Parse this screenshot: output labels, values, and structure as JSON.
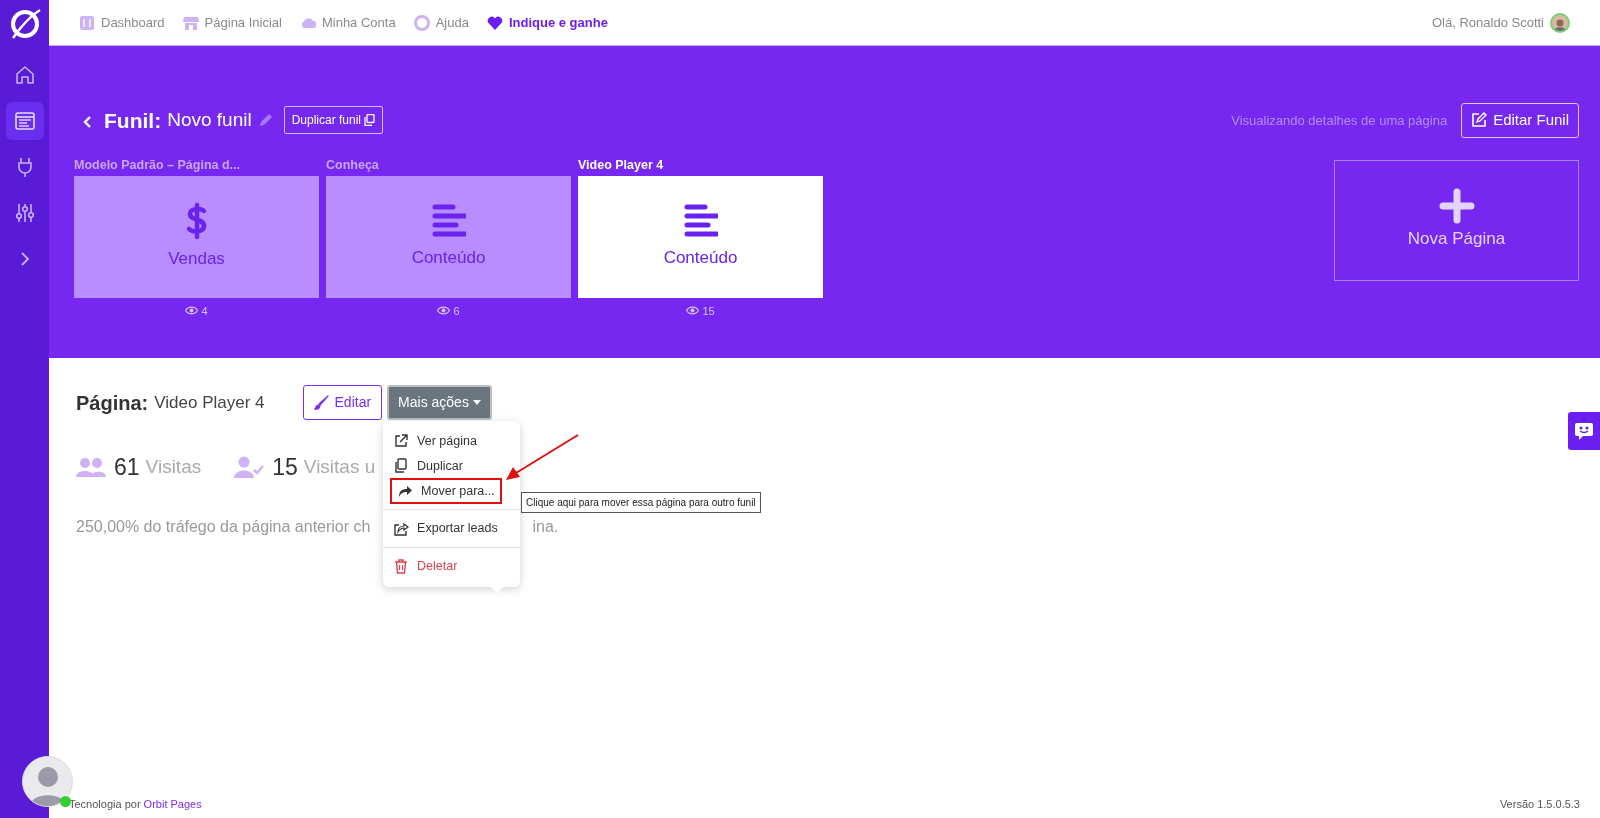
{
  "sidebar": {
    "items": [
      {
        "kind": "home",
        "selected": false
      },
      {
        "kind": "pages",
        "selected": true
      },
      {
        "kind": "plug",
        "selected": false
      },
      {
        "kind": "sliders",
        "selected": false
      },
      {
        "kind": "chevron",
        "selected": false
      }
    ]
  },
  "topnav": {
    "links": [
      {
        "kind": "dashboard",
        "label": "Dashboard",
        "highlight": false
      },
      {
        "kind": "store",
        "label": "Página Inicial",
        "highlight": false
      },
      {
        "kind": "cloud",
        "label": "Minha Conta",
        "highlight": false
      },
      {
        "kind": "lifebuoy",
        "label": "Ajuda",
        "highlight": false
      },
      {
        "kind": "heart",
        "label": "Indique e ganhe",
        "highlight": true
      }
    ],
    "greeting": "Olá, Ronaldo Scotti"
  },
  "funnel": {
    "heading": "Funil:",
    "name": "Novo funil",
    "duplicate_button": "Duplicar funil",
    "info": "Visualizando detalhes de uma página",
    "edit_button": "Editar Funil",
    "pages": [
      {
        "title": "Modelo Padrão – Página d...",
        "type": "Vendas",
        "kind": "sales",
        "views": "4",
        "selected": false
      },
      {
        "title": "Conheça",
        "type": "Conteúdo",
        "kind": "content",
        "views": "6",
        "selected": false
      },
      {
        "title": "Video Player 4",
        "type": "Conteúdo",
        "kind": "content",
        "views": "15",
        "selected": true
      }
    ],
    "new_page": "Nova Página"
  },
  "page": {
    "heading": "Página:",
    "name": "Video Player 4",
    "edit_button": "Editar",
    "more_button": "Mais ações",
    "menu": [
      {
        "kind": "external",
        "label": "Ver página",
        "danger": false,
        "annotated": false,
        "divider_before": false
      },
      {
        "kind": "copy",
        "label": "Duplicar",
        "danger": false,
        "annotated": false,
        "divider_before": false
      },
      {
        "kind": "share",
        "label": "Mover para...",
        "danger": false,
        "annotated": true,
        "divider_before": false
      },
      {
        "kind": "export",
        "label": "Exportar leads",
        "danger": false,
        "annotated": false,
        "divider_before": true
      },
      {
        "kind": "trash",
        "label": "Deletar",
        "danger": true,
        "annotated": false,
        "divider_before": true
      }
    ],
    "tooltip": "Clique aqui para mover essa página para outro funil"
  },
  "stats": [
    {
      "kind": "users",
      "value": "61",
      "label": "Visitas"
    },
    {
      "kind": "user-check",
      "value": "15",
      "label": "Visitas u"
    }
  ],
  "conversion_text": [
    "250,00% do tráfego da página anterior ch",
    "ina."
  ],
  "footer": {
    "credit": "Tecnologia por",
    "link": "Orbit Pages",
    "version": "Versão 1.5.0.5.3"
  }
}
